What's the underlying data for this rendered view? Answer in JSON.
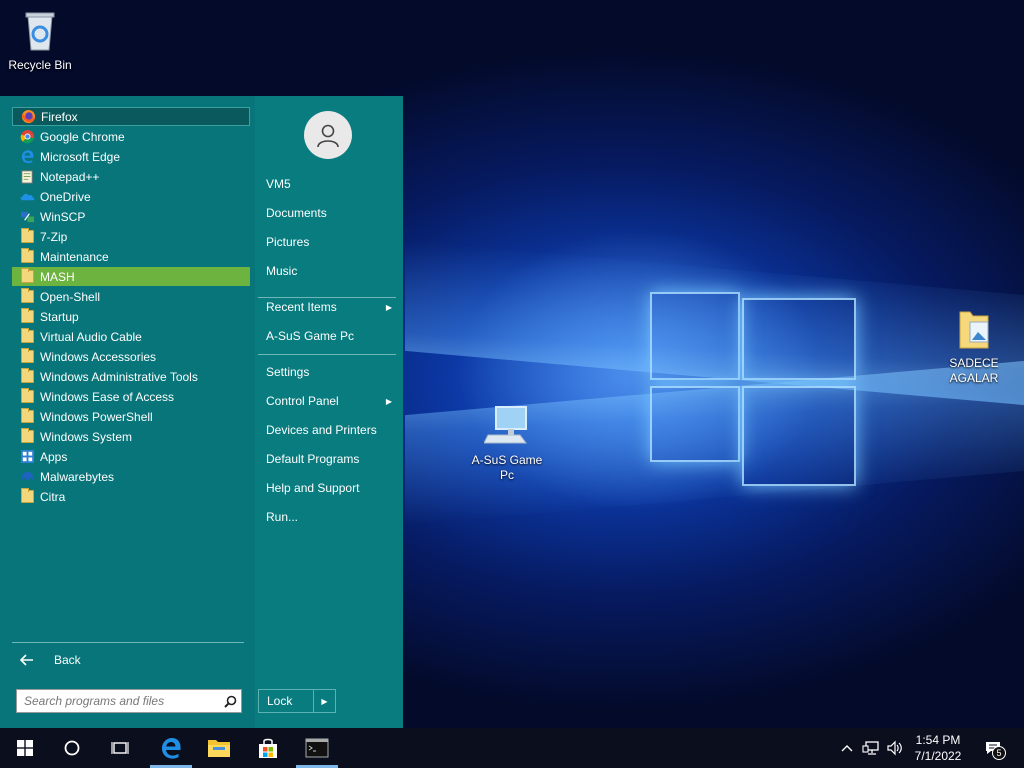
{
  "desktop": {
    "icons": [
      {
        "label": "Recycle Bin"
      },
      {
        "label": "A-SuS Game Pc"
      },
      {
        "label": "SADECE AGALAR"
      }
    ]
  },
  "start_menu": {
    "programs": [
      {
        "label": "Firefox",
        "icon": "firefox-icon"
      },
      {
        "label": "Google Chrome",
        "icon": "chrome-icon"
      },
      {
        "label": "Microsoft Edge",
        "icon": "edge-icon"
      },
      {
        "label": "Notepad++",
        "icon": "notepadpp-icon"
      },
      {
        "label": "OneDrive",
        "icon": "onedrive-icon"
      },
      {
        "label": "WinSCP",
        "icon": "winscp-icon"
      },
      {
        "label": "7-Zip",
        "icon": "folder-icon"
      },
      {
        "label": "Maintenance",
        "icon": "folder-icon"
      },
      {
        "label": "MASH",
        "icon": "folder-icon"
      },
      {
        "label": "Open-Shell",
        "icon": "folder-icon"
      },
      {
        "label": "Startup",
        "icon": "folder-icon"
      },
      {
        "label": "Virtual Audio Cable",
        "icon": "folder-icon"
      },
      {
        "label": "Windows Accessories",
        "icon": "folder-icon"
      },
      {
        "label": "Windows Administrative Tools",
        "icon": "folder-icon"
      },
      {
        "label": "Windows Ease of Access",
        "icon": "folder-icon"
      },
      {
        "label": "Windows PowerShell",
        "icon": "folder-icon"
      },
      {
        "label": "Windows System",
        "icon": "folder-icon"
      },
      {
        "label": "Apps",
        "icon": "apps-icon"
      },
      {
        "label": "Malwarebytes",
        "icon": "malwarebytes-icon"
      },
      {
        "label": "Citra",
        "icon": "folder-icon"
      }
    ],
    "back_label": "Back",
    "search_placeholder": "Search programs and files",
    "right_items": [
      {
        "label": "VM5"
      },
      {
        "label": "Documents"
      },
      {
        "label": "Pictures"
      },
      {
        "label": "Music"
      },
      {
        "label": "Recent Items",
        "submenu": true
      },
      {
        "label": "A-SuS Game Pc"
      },
      {
        "label": "Settings"
      },
      {
        "label": "Control Panel",
        "submenu": true
      },
      {
        "label": "Devices and Printers"
      },
      {
        "label": "Default Programs"
      },
      {
        "label": "Help and Support"
      },
      {
        "label": "Run..."
      }
    ],
    "lock_label": "Lock",
    "highlight_color": "#6db33f",
    "menu_color": "#087c7f"
  },
  "taskbar": {
    "time": "1:54 PM",
    "date": "7/1/2022",
    "notification_count": "5",
    "pinned": [
      "start-icon",
      "cortana-icon",
      "task-view-icon",
      "edge-icon",
      "file-explorer-icon",
      "store-icon",
      "cmd-icon"
    ]
  }
}
